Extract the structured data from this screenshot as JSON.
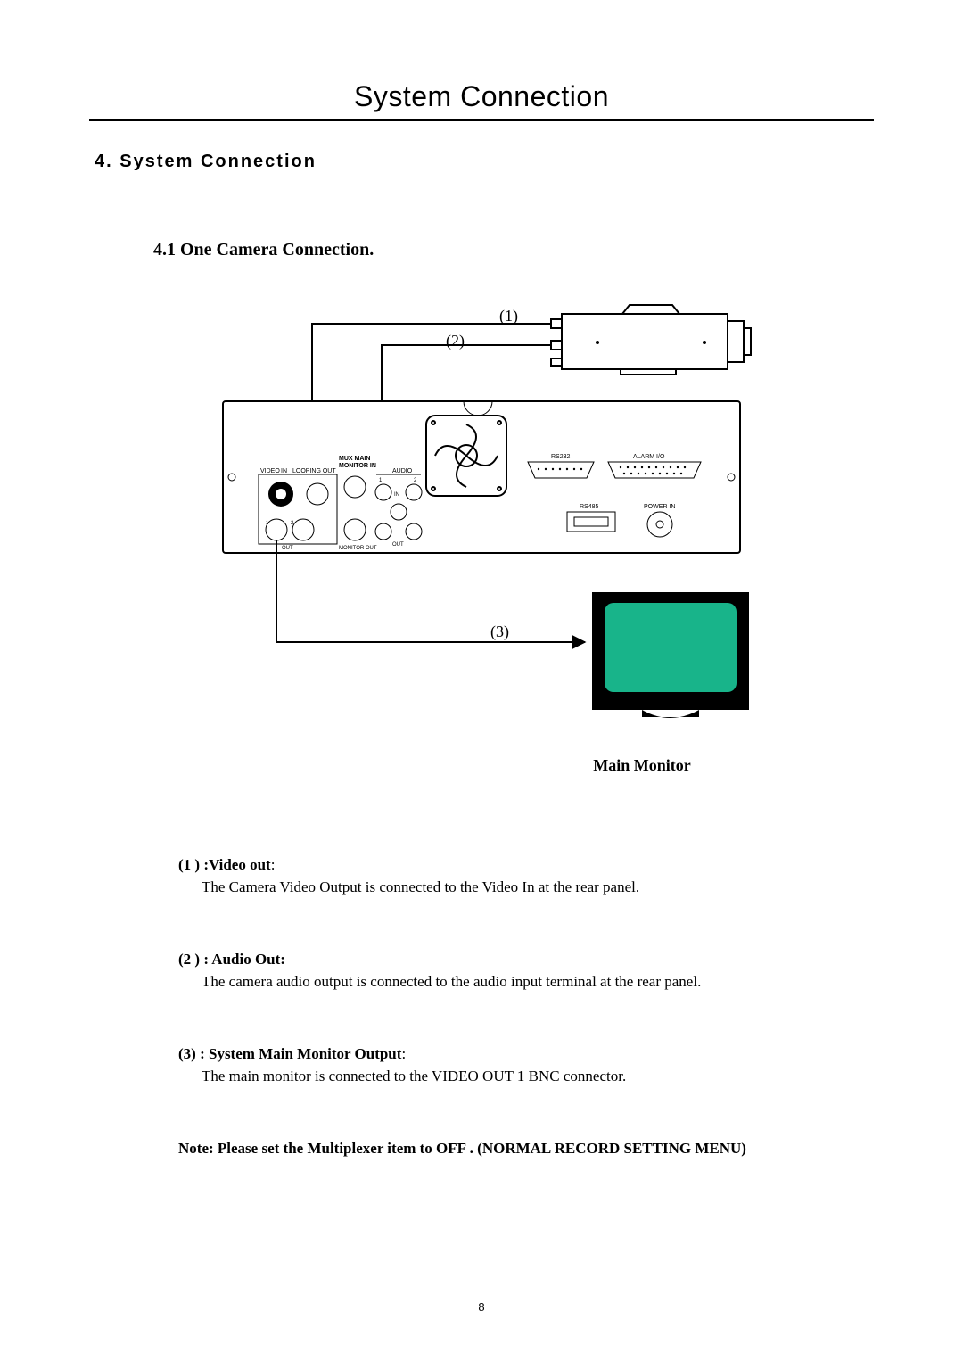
{
  "page_title": "System Connection",
  "section_heading": "4. System Connection",
  "subsection_heading": "4.1  One Camera  Connection.",
  "diagram": {
    "label_1": "(1)",
    "label_2": "(2)",
    "label_3": "(3)",
    "monitor_caption": "Main Monitor",
    "rear_panel": {
      "mux_main": "MUX MAIN",
      "monitor_in": "MONITOR IN",
      "video": "VIDEO",
      "in": "IN",
      "loop": "LOOPING OUT",
      "audio": "AUDIO",
      "one": "1",
      "two": "2",
      "in2": "IN",
      "out_row": "OUT",
      "monitor_out": "MONITOR OUT",
      "rs232": "RS232",
      "rs485": "RS485",
      "alarm_io": "ALARM I/O",
      "power_in": "POWER IN"
    },
    "colors": {
      "monitor_screen": "#18b48a",
      "monitor_body": "#000000"
    }
  },
  "definitions": [
    {
      "label": "(1 ) :Video  out",
      "suffix": ":",
      "body": "The Camera Video Output is connected to the Video In at the rear panel."
    },
    {
      "label": "(2 ) :  Audio Out:",
      "suffix": "",
      "body": "The camera audio output is connected to the audio input terminal at the rear panel."
    },
    {
      "label": "(3) :  System Main Monitor Output",
      "suffix": ":",
      "body": "The main monitor is connected to the VIDEO OUT 1 BNC connector."
    }
  ],
  "note": "Note: Please set the Multiplexer item to OFF . (NORMAL RECORD SETTING MENU)",
  "page_number": "8"
}
